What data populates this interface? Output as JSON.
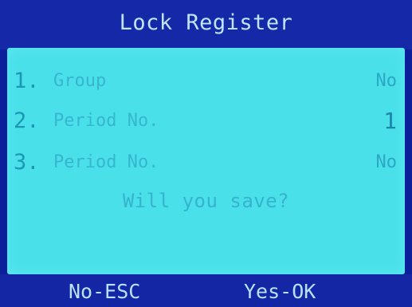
{
  "title": "Lock Register",
  "rows": [
    {
      "num": "1.",
      "label": "Group",
      "value": "No"
    },
    {
      "num": "2.",
      "label": "Period No.",
      "value": "1"
    },
    {
      "num": "3.",
      "label": "Period No.",
      "value": "No"
    }
  ],
  "prompt": "Will you save?",
  "softkeys": {
    "left": "No-ESC",
    "right": "Yes-OK"
  },
  "colors": {
    "frame": "#0c1f9a",
    "panel": "#4ae0ea",
    "header_text": "#bfe6ff",
    "body_text": "#36b6cf"
  }
}
